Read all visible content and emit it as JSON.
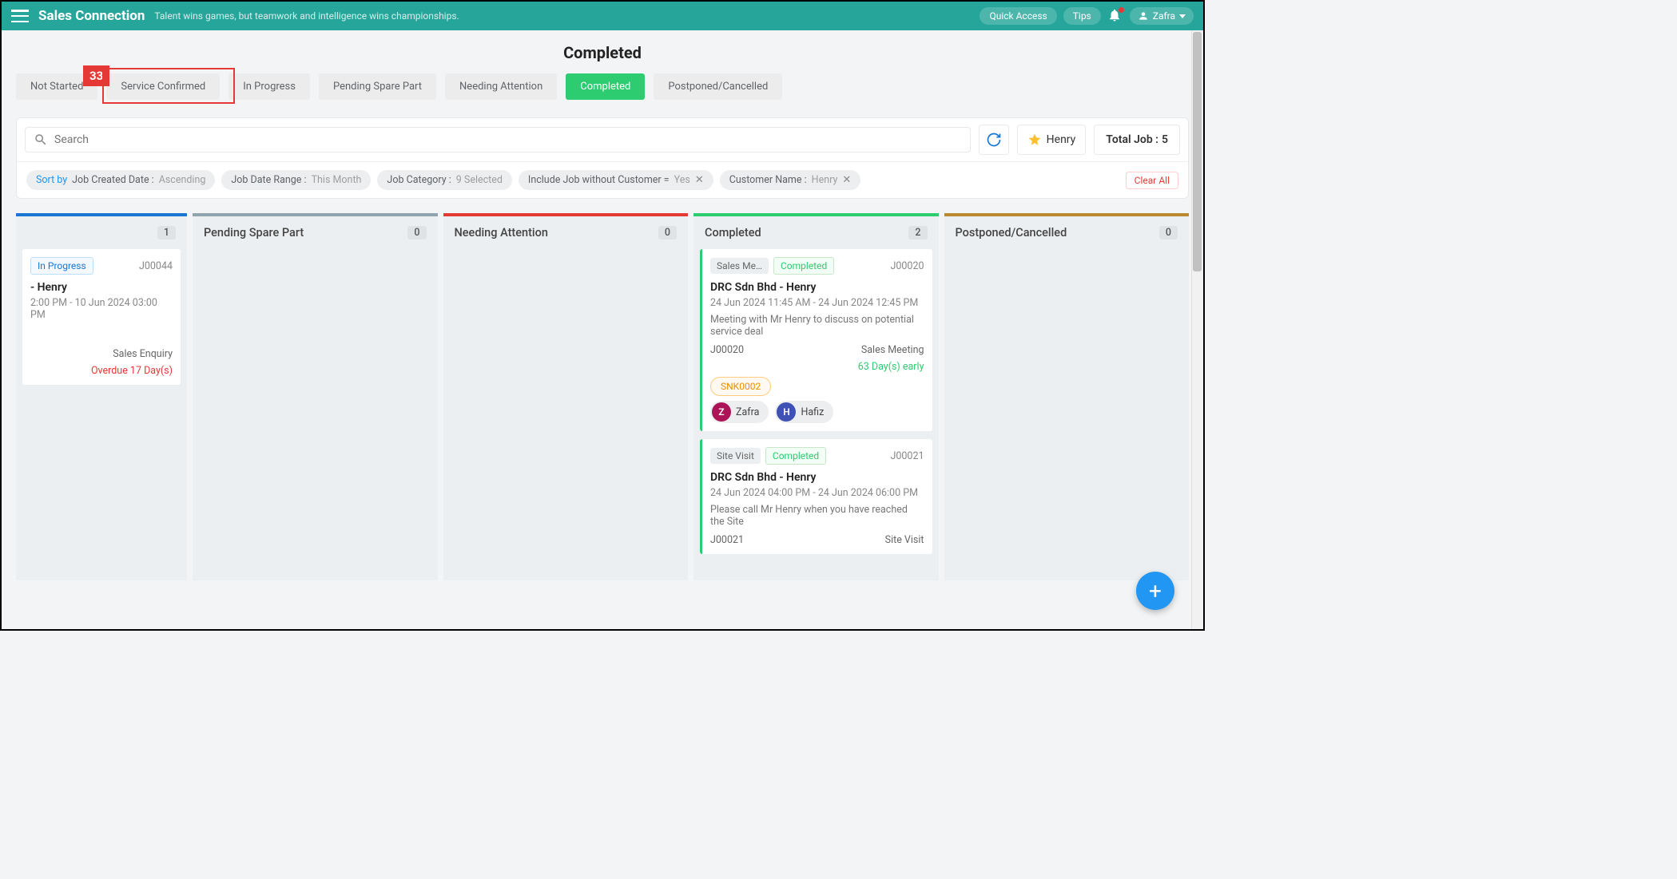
{
  "header": {
    "brand": "Sales Connection",
    "tagline": "Talent wins games, but teamwork and intelligence wins championships.",
    "quick_access": "Quick Access",
    "tips": "Tips",
    "user": "Zafra"
  },
  "page_title": "Completed",
  "callout_number": "33",
  "tabs": [
    {
      "label": "Not Started",
      "active": false
    },
    {
      "label": "Service Confirmed",
      "active": false
    },
    {
      "label": "In Progress",
      "active": false
    },
    {
      "label": "Pending Spare Part",
      "active": false
    },
    {
      "label": "Needing Attention",
      "active": false
    },
    {
      "label": "Completed",
      "active": true
    },
    {
      "label": "Postponed/Cancelled",
      "active": false
    }
  ],
  "search": {
    "placeholder": "Search"
  },
  "favorite_label": "Henry",
  "total_label": "Total Job :",
  "total_value": "5",
  "chips": {
    "sort": {
      "prefix": "Sort by",
      "field": "Job Created Date :",
      "value": "Ascending"
    },
    "range": {
      "field": "Job Date Range :",
      "value": "This Month"
    },
    "category": {
      "field": "Job Category :",
      "value": "9 Selected"
    },
    "include": {
      "field": "Include Job without Customer =",
      "value": "Yes"
    },
    "customer": {
      "field": "Customer Name :",
      "value": "Henry"
    }
  },
  "clear_all": "Clear All",
  "columns": [
    {
      "title": "",
      "count": "1",
      "color": "c-blue"
    },
    {
      "title": "Pending Spare Part",
      "count": "0",
      "color": "c-slate"
    },
    {
      "title": "Needing Attention",
      "count": "0",
      "color": "c-red"
    },
    {
      "title": "Completed",
      "count": "2",
      "color": "c-green"
    },
    {
      "title": "Postponed/Cancelled",
      "count": "0",
      "color": "c-brown"
    }
  ],
  "card_inprogress": {
    "status": "In Progress",
    "id": "J00044",
    "title": "- Henry",
    "time": "2:00 PM - 10 Jun 2024 03:00 PM",
    "category": "Sales Enquiry",
    "overdue": "Overdue 17 Day(s)"
  },
  "card_completed_1": {
    "cat_tag": "Sales Me…",
    "status": "Completed",
    "id": "J00020",
    "title": "DRC Sdn Bhd - Henry",
    "time": "24 Jun 2024 11:45 AM - 24 Jun 2024 12:45 PM",
    "desc": "Meeting with Mr Henry to discuss on potential service deal",
    "foot_id": "J00020",
    "foot_cat": "Sales Meeting",
    "early": "63 Day(s) early",
    "ref": "SNK0002",
    "av1": "Zafra",
    "av1i": "Z",
    "av2": "Hafiz",
    "av2i": "H"
  },
  "card_completed_2": {
    "cat_tag": "Site Visit",
    "status": "Completed",
    "id": "J00021",
    "title": "DRC Sdn Bhd - Henry",
    "time": "24 Jun 2024 04:00 PM - 24 Jun 2024 06:00 PM",
    "desc": "Please call Mr Henry when you have reached the Site",
    "foot_id": "J00021",
    "foot_cat": "Site Visit"
  }
}
